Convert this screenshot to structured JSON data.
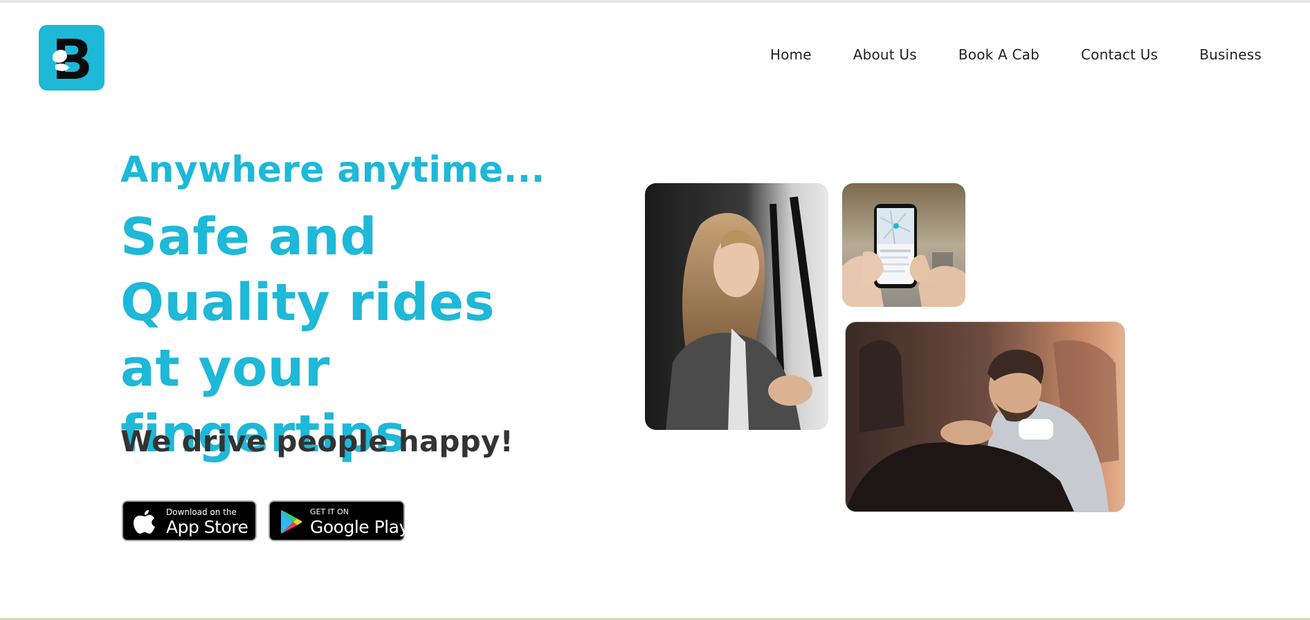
{
  "brand": {
    "logo_icon": "b-letter-logo-icon",
    "accent_color": "#1eb8d8"
  },
  "nav": {
    "items": [
      {
        "label": "Home"
      },
      {
        "label": "About Us"
      },
      {
        "label": "Book A Cab"
      },
      {
        "label": "Contact Us"
      },
      {
        "label": "Business"
      }
    ]
  },
  "hero": {
    "tagline": "Anywhere anytime...",
    "headline": "Safe and Quality rides at your fingertips",
    "subline": "We drive people happy!"
  },
  "stores": {
    "app_store": {
      "small": "Download on the",
      "big": "App Store",
      "icon": "apple-icon"
    },
    "google_play": {
      "small": "GET IT ON",
      "big": "Google Play",
      "icon": "google-play-icon"
    }
  },
  "photos": {
    "woman": "woman-in-taxi-photo",
    "phone": "phone-map-app-photo",
    "man": "smiling-driver-photo"
  }
}
